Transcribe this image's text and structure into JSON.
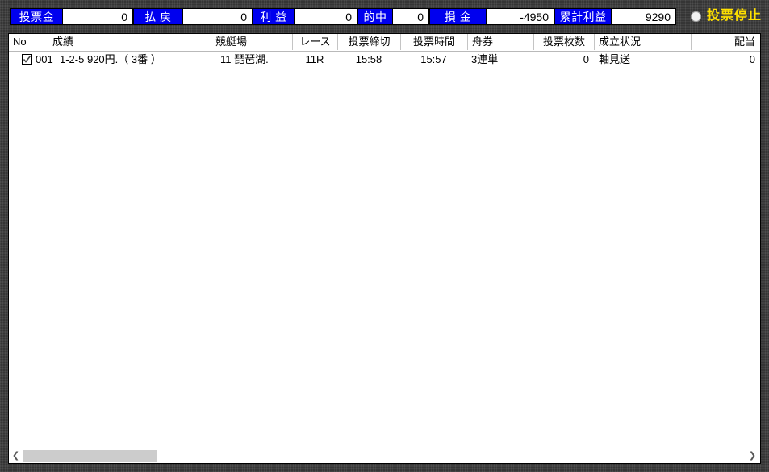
{
  "window": {
    "accent_blue": "#0000ee",
    "status_yellow": "#ffe000",
    "frame_color": "#3b3b3b"
  },
  "summary": {
    "fields": [
      {
        "label": "投票金",
        "value": "0"
      },
      {
        "label": "払 戻",
        "value": "0"
      },
      {
        "label": "利 益",
        "value": "0"
      },
      {
        "label": "的中",
        "value": "0"
      },
      {
        "label": "損 金",
        "value": "-4950"
      },
      {
        "label": "累計利益",
        "value": "9290"
      }
    ],
    "status": {
      "indicator": "status-dot",
      "text": "投票停止"
    }
  },
  "grid": {
    "columns": [
      {
        "key": "no",
        "label": "No"
      },
      {
        "key": "result",
        "label": "成績"
      },
      {
        "key": "venue",
        "label": "競艇場"
      },
      {
        "key": "race",
        "label": "レース"
      },
      {
        "key": "deadline",
        "label": "投票締切"
      },
      {
        "key": "vote_time",
        "label": "投票時間"
      },
      {
        "key": "ticket",
        "label": "舟券"
      },
      {
        "key": "tickets",
        "label": "投票枚数"
      },
      {
        "key": "status",
        "label": "成立状況"
      },
      {
        "key": "payout",
        "label": "配当"
      }
    ],
    "rows": [
      {
        "checked": true,
        "no": "001",
        "result": "1-2-5 920円.（ 3番 ）",
        "venue": "11 琵琶湖.",
        "race": "11R",
        "deadline": "15:58",
        "vote_time": "15:57",
        "ticket": "3連単",
        "tickets": "0",
        "status": "軸見送",
        "payout": "0"
      }
    ]
  },
  "scrollbar": {
    "left_arrow": "❮",
    "right_arrow": "❯"
  }
}
